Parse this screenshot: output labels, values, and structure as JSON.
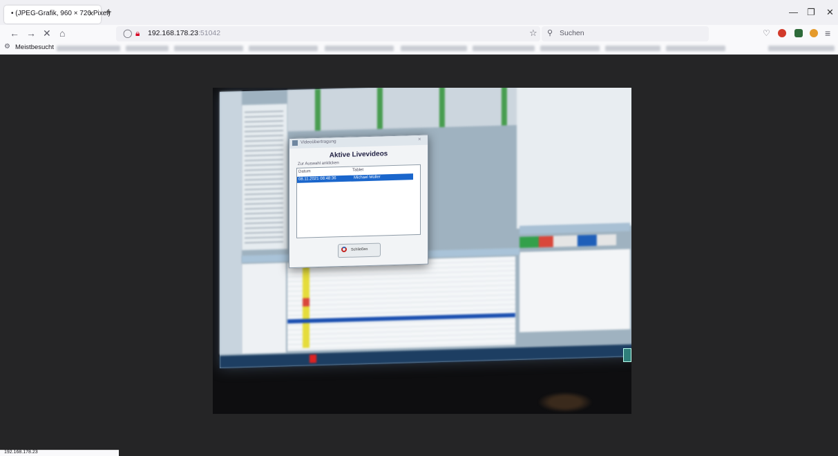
{
  "browser": {
    "tab_title": "• (JPEG-Grafik, 960 × 720 Pixel)",
    "url_host": "192.168.178.23",
    "url_port": ":51042",
    "search_placeholder": "Suchen",
    "bookmarks_label": "Meistbesucht",
    "status_url": "192.168.178.23"
  },
  "photo": {
    "dialog_title": "Videoübertragung",
    "dialog_heading": "Aktive Livevideos",
    "dialog_hint": "Zur Auswahl anklicken",
    "column_date": "Datum",
    "column_tablet": "Tablet",
    "row_date": "08.11.2021 08:48:36",
    "row_tablet": "Michael Müller",
    "close_label": "Schließen"
  },
  "colors": {
    "selection": "#1a66cc",
    "close_icon_red": "#c4221f"
  },
  "icons": [
    "close-icon",
    "new-tab-icon",
    "back-icon",
    "forward-icon",
    "reload-stop-icon",
    "home-icon",
    "shield-icon",
    "lock-warning-icon",
    "star-icon",
    "search-icon",
    "pocket-icon",
    "extension-icon",
    "menu-icon",
    "minimize-icon",
    "maximize-icon",
    "window-close-icon",
    "gear-icon"
  ]
}
